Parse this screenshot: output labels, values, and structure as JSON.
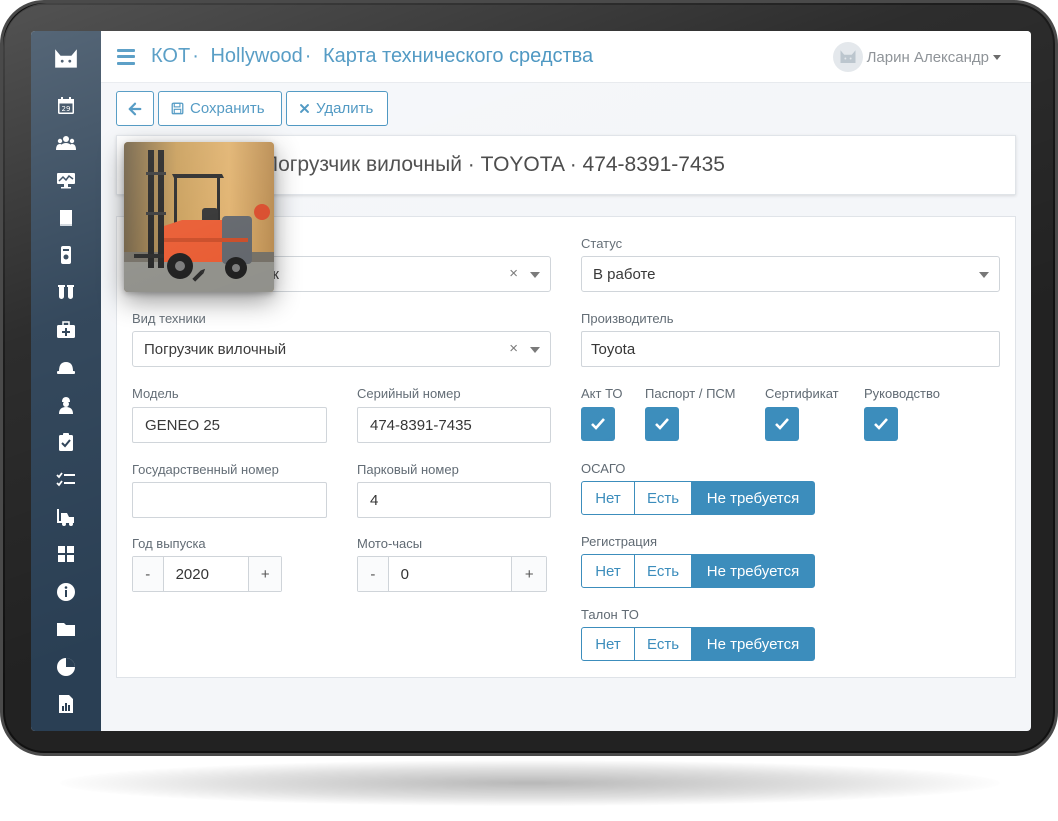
{
  "app": {
    "brand_icon": "cat-logo-icon"
  },
  "sidebar": {
    "items": [
      {
        "icon": "calendar-icon",
        "day": "29"
      },
      {
        "icon": "users-icon"
      },
      {
        "icon": "monitor-chart-icon"
      },
      {
        "icon": "book-icon"
      },
      {
        "icon": "device-doc-icon"
      },
      {
        "icon": "test-tubes-icon"
      },
      {
        "icon": "first-aid-kit-icon"
      },
      {
        "icon": "hard-hat-icon"
      },
      {
        "icon": "worker-icon"
      },
      {
        "icon": "clipboard-check-icon"
      },
      {
        "icon": "checklist-icon"
      },
      {
        "icon": "forklift-icon"
      },
      {
        "icon": "puzzle-icon"
      },
      {
        "icon": "info-icon"
      },
      {
        "icon": "folder-icon"
      },
      {
        "icon": "pie-chart-icon"
      },
      {
        "icon": "report-icon"
      }
    ]
  },
  "header": {
    "breadcrumb": [
      "КОТ",
      "Hollywood",
      "Карта технического средства"
    ],
    "separator": "·",
    "user_name": "Ларин Александр"
  },
  "toolbar": {
    "save_label": "Сохранить",
    "delete_label": "Удалить"
  },
  "title": "Погрузчик вилочный · TOYOTA · 474-8391-7435",
  "form": {
    "hidden_select_value_tail": "ек",
    "status_label": "Статус",
    "status_value": "В работе",
    "kind_label": "Вид техники",
    "kind_value": "Погрузчик вилочный",
    "manufacturer_label": "Производитель",
    "manufacturer_value": "Toyota",
    "model_label": "Модель",
    "model_value": "GENEO 25",
    "serial_label": "Серийный номер",
    "serial_value": "474-8391-7435",
    "state_number_label": "Государственный номер",
    "state_number_value": "",
    "park_number_label": "Парковый номер",
    "park_number_value": "4",
    "year_label": "Год выпуска",
    "year_value": "2020",
    "hours_label": "Мото-часы",
    "hours_value": "0",
    "minus": "-",
    "plus": "+",
    "clear": "×",
    "checkboxes": [
      {
        "label": "Акт ТО",
        "checked": true
      },
      {
        "label": "Паспорт / ПСМ",
        "checked": true
      },
      {
        "label": "Сертификат",
        "checked": true
      },
      {
        "label": "Руководство",
        "checked": true
      }
    ],
    "toggles": [
      {
        "label": "ОСАГО",
        "options": [
          "Нет",
          "Есть",
          "Не требуется"
        ],
        "selected": "Не требуется"
      },
      {
        "label": "Регистрация",
        "options": [
          "Нет",
          "Есть",
          "Не требуется"
        ],
        "selected": "Не требуется"
      },
      {
        "label": "Талон ТО",
        "options": [
          "Нет",
          "Есть",
          "Не требуется"
        ],
        "selected": "Не требуется"
      }
    ]
  },
  "colors": {
    "accent": "#3c8dbc",
    "sidebar": "#2a3f54",
    "forklift": "#e8552a"
  }
}
